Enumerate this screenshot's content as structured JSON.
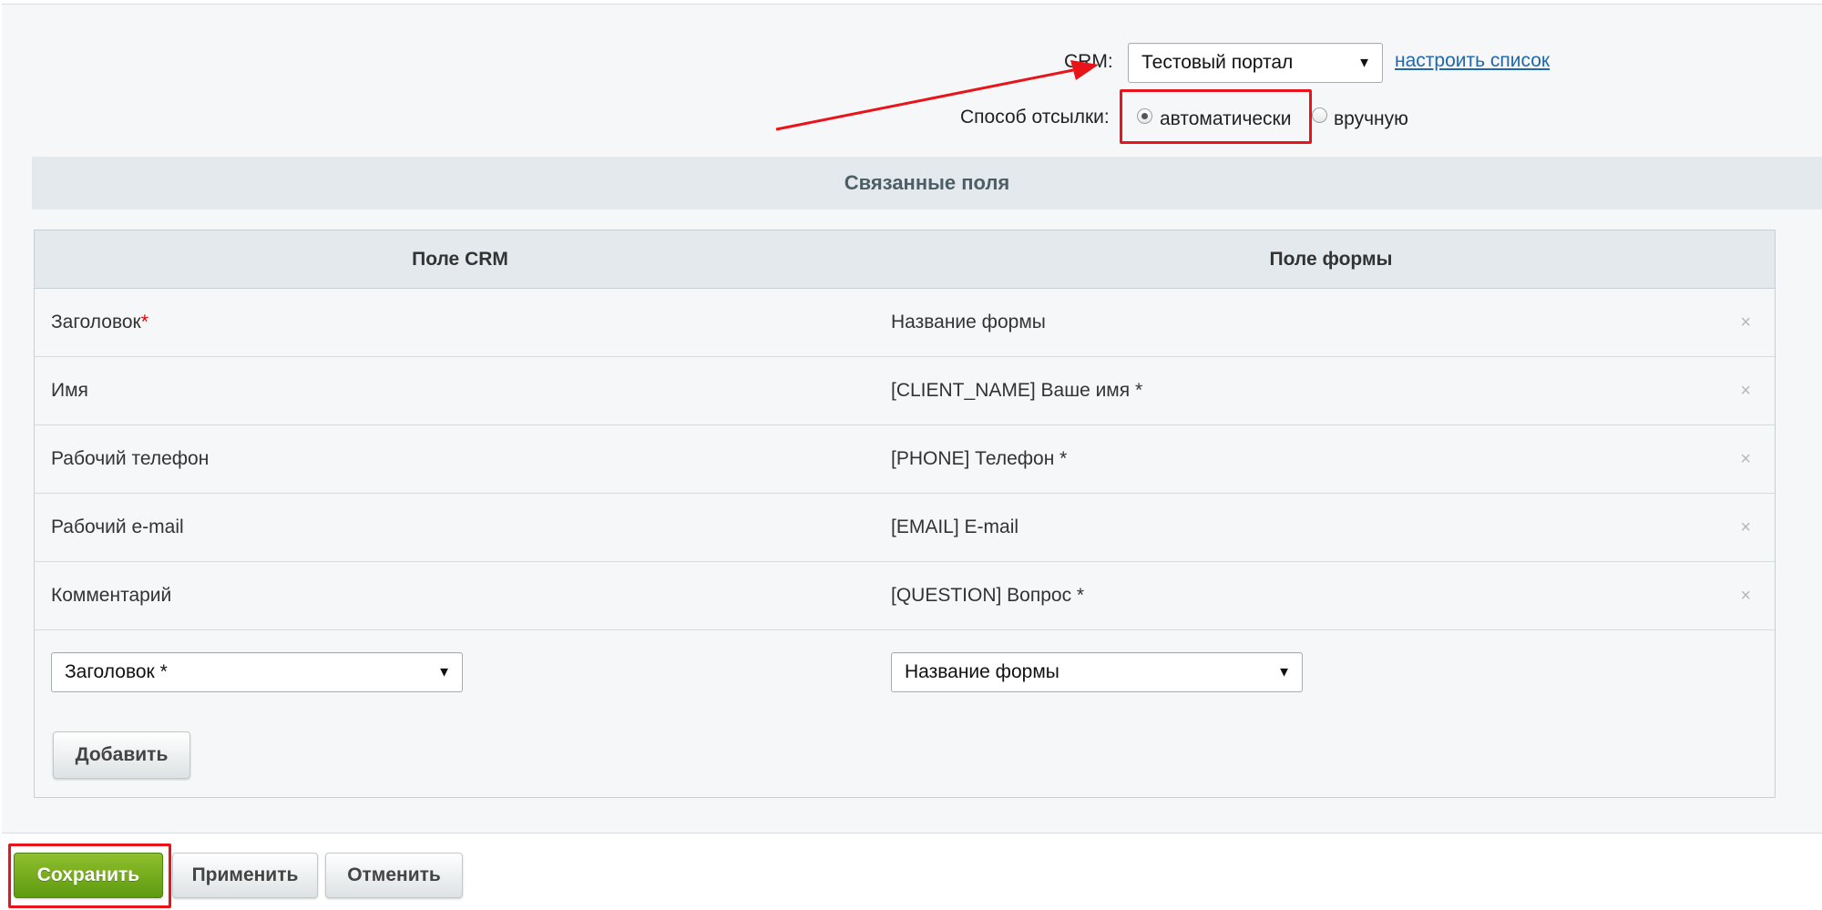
{
  "crm": {
    "label": "CRM:",
    "selected": "Тестовый портал",
    "configure_link": "настроить список"
  },
  "send_method": {
    "label": "Способ отсылки:",
    "options": [
      {
        "label": "автоматически",
        "checked": true
      },
      {
        "label": "вручную",
        "checked": false
      }
    ]
  },
  "section": {
    "title": "Связанные поля"
  },
  "table": {
    "columns": [
      "Поле CRM",
      "Поле формы"
    ],
    "rows": [
      {
        "crm_field": "Заголовок",
        "required": "*",
        "form_field": "Название формы"
      },
      {
        "crm_field": "Имя",
        "form_field": "[CLIENT_NAME] Ваше имя *"
      },
      {
        "crm_field": "Рабочий телефон",
        "form_field": "[PHONE] Телефон *"
      },
      {
        "crm_field": "Рабочий e-mail",
        "form_field": "[EMAIL] E-mail"
      },
      {
        "crm_field": "Комментарий",
        "form_field": "[QUESTION] Вопрос *"
      }
    ],
    "new_crm_select": "Заголовок *",
    "new_form_select": "Название формы",
    "add_label": "Добавить",
    "remove_glyph": "×"
  },
  "footer": {
    "save_label": "Сохранить",
    "apply_label": "Применить",
    "cancel_label": "Отменить"
  },
  "colors": {
    "accent_green": "#6fa81c",
    "annotation_red": "#e8141a",
    "link_blue": "#2067b0"
  },
  "icons": {
    "dropdown": "triangle-down",
    "remove": "close-x",
    "annotation": "red-arrow"
  }
}
